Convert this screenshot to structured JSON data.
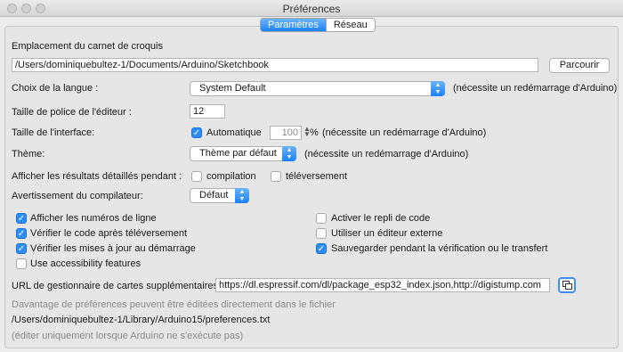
{
  "window": {
    "title": "Préférences"
  },
  "tabs": [
    {
      "label": "Paramètres",
      "active": true
    },
    {
      "label": "Réseau",
      "active": false
    }
  ],
  "sketchbook": {
    "label": "Emplacement du carnet de croquis",
    "path": "/Users/dominiquebultez-1/Documents/Arduino/Sketchbook",
    "browse_label": "Parcourir"
  },
  "language": {
    "label": "Choix de la langue :",
    "value": "System Default",
    "note": "(nécessite un redémarrage d'Arduino)"
  },
  "font_size": {
    "label": "Taille de police de l'éditeur :",
    "value": "12"
  },
  "interface_scale": {
    "label": "Taille de l'interface:",
    "auto_label": "Automatique",
    "auto_checked": true,
    "value": "100",
    "unit": "%",
    "note": "(nécessite un redémarrage d'Arduino)"
  },
  "theme": {
    "label": "Thème:",
    "value": "Thème par défaut",
    "note": "(nécessite un redémarrage d'Arduino)"
  },
  "verbose": {
    "label": "Afficher les résultats détaillés pendant :",
    "compile_label": "compilation",
    "compile_checked": false,
    "upload_label": "téléversement",
    "upload_checked": false
  },
  "warnings": {
    "label": "Avertissement du compilateur:",
    "value": "Défaut"
  },
  "options_left": [
    {
      "label": "Afficher les numéros de ligne",
      "checked": true
    },
    {
      "label": "Vérifier le code après téléversement",
      "checked": true
    },
    {
      "label": "Vérifier les mises à jour au démarrage",
      "checked": true
    },
    {
      "label": "Use accessibility features",
      "checked": false
    }
  ],
  "options_right": [
    {
      "label": "Activer le repli de code",
      "checked": false
    },
    {
      "label": "Utiliser un éditeur externe",
      "checked": false
    },
    {
      "label": "Sauvegarder pendant la vérification ou le transfert",
      "checked": true
    }
  ],
  "board_urls": {
    "label": "URL de gestionnaire de cartes supplémentaires",
    "value": "https://dl.espressif.com/dl/package_esp32_index.json,http://digistump.com"
  },
  "footer": {
    "line1": "Davantage de préférences peuvent être éditées directement dans le fichier",
    "path": "/Users/dominiquebultez-1/Library/Arduino15/preferences.txt",
    "line3": "(éditer uniquement lorsque Arduino ne s'exécute pas)"
  },
  "colors": {
    "accent": "#1a82fb",
    "checkbox_on": "#2d8cf5"
  },
  "icons": {
    "dropdown": "chevron-updown-icon",
    "checkmark": "checkmark-icon",
    "copy": "copy-icon"
  }
}
